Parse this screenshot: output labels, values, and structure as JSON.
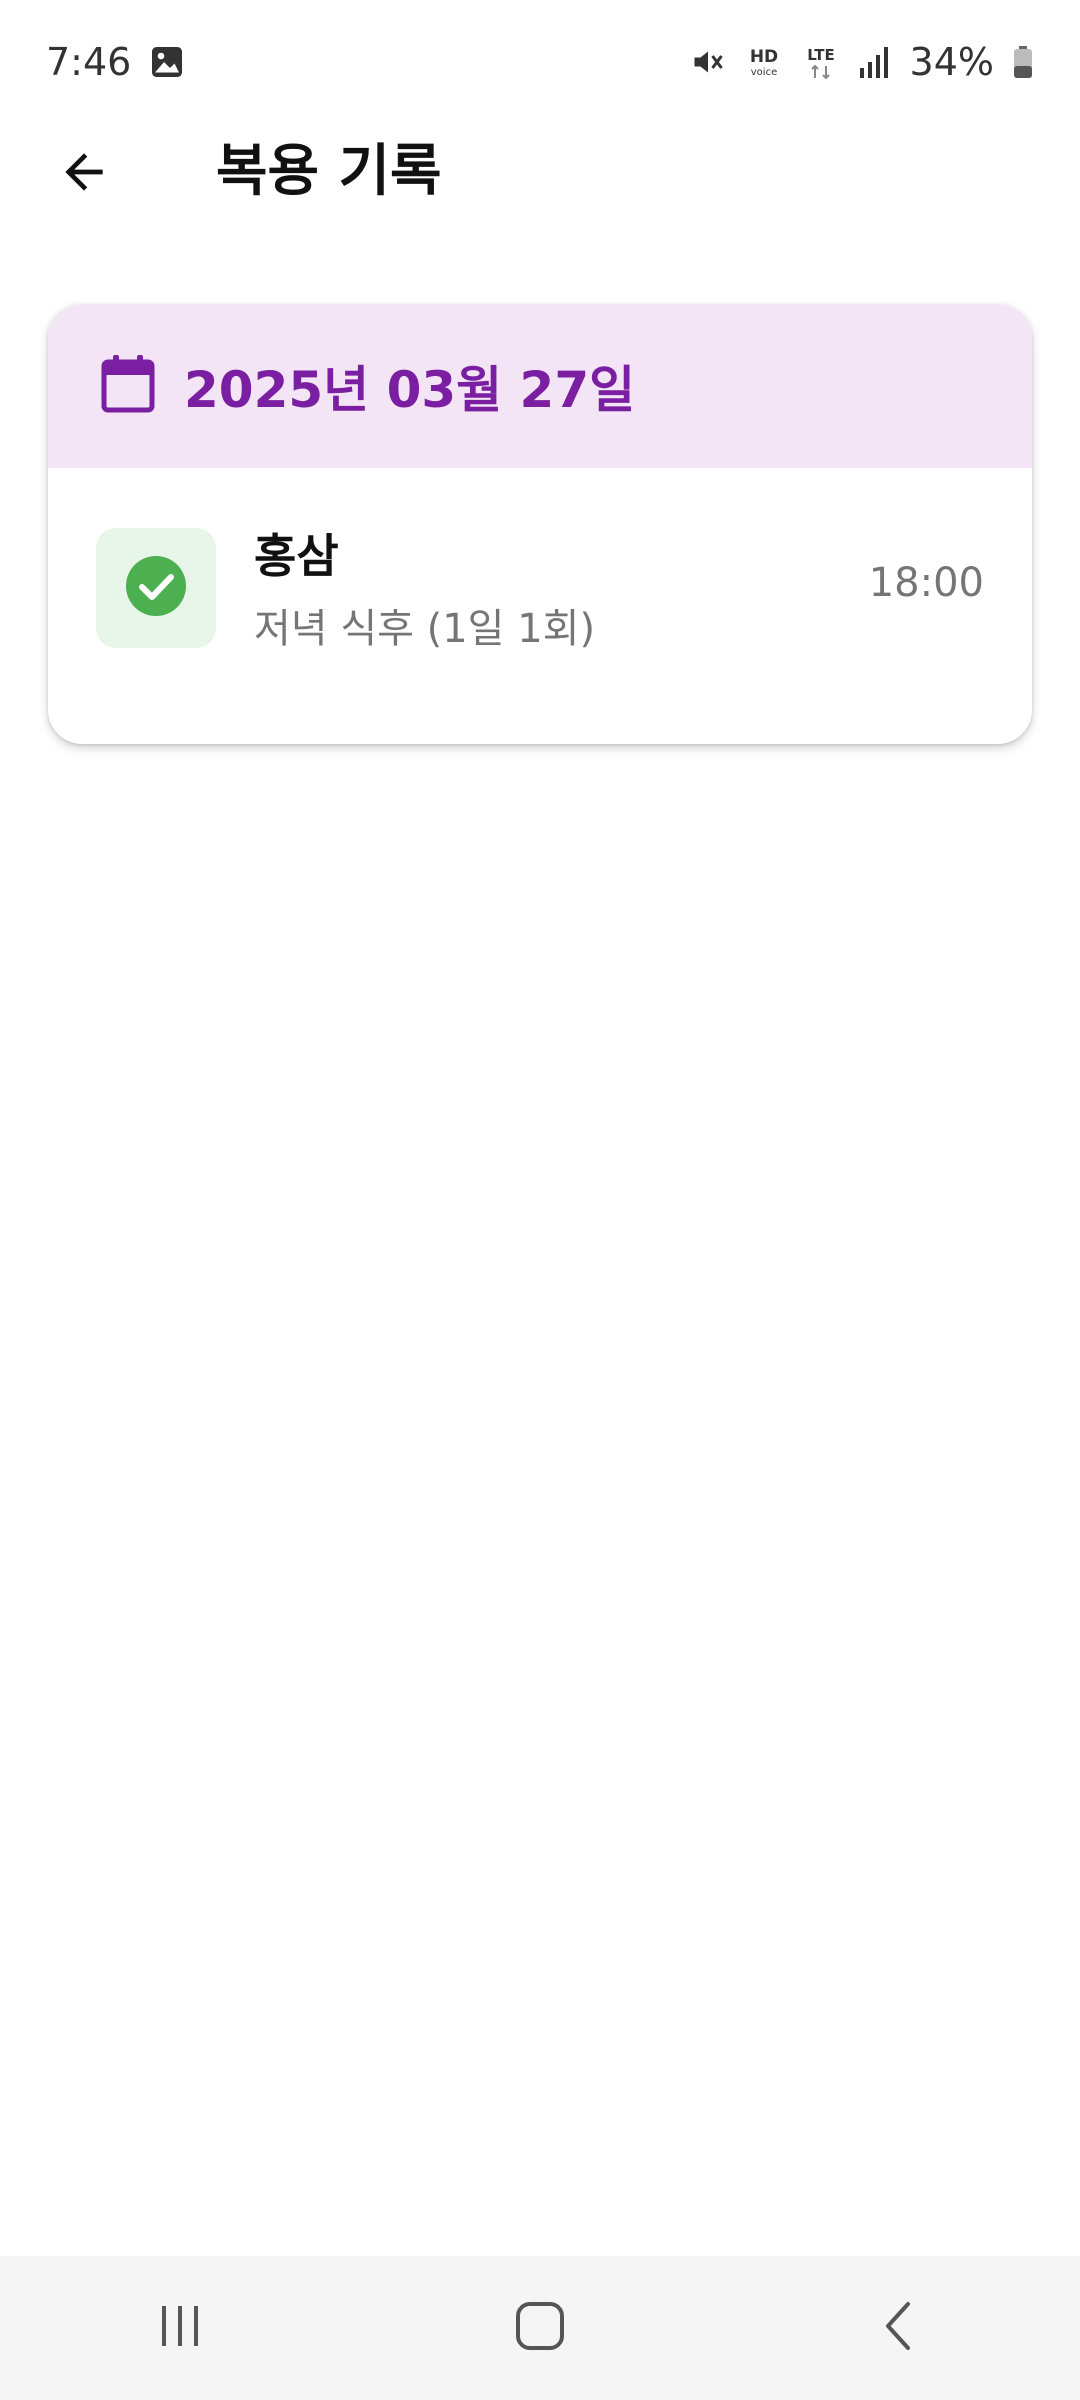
{
  "status_bar": {
    "time": "7:46",
    "battery": "34%",
    "icons": [
      "image-icon",
      "mute-icon",
      "hd-voice-icon",
      "lte-icon",
      "signal-icon",
      "battery-icon"
    ]
  },
  "app_bar": {
    "title": "복용 기록",
    "back_icon": "arrow-back-icon"
  },
  "record": {
    "date": "2025년 03월 27일",
    "date_icon": "calendar-icon",
    "items": [
      {
        "name": "홍삼",
        "schedule": "저녁 식후 (1일 1회)",
        "time": "18:00",
        "status_icon": "check-circle-icon"
      }
    ]
  },
  "nav_bar": {
    "buttons": [
      "recents-icon",
      "home-icon",
      "back-nav-icon"
    ]
  },
  "colors": {
    "accent": "#7b1fa2",
    "header_bg": "#f3e5f5",
    "success": "#4caf50",
    "success_bg": "#e8f5e9",
    "muted_text": "#757575"
  }
}
